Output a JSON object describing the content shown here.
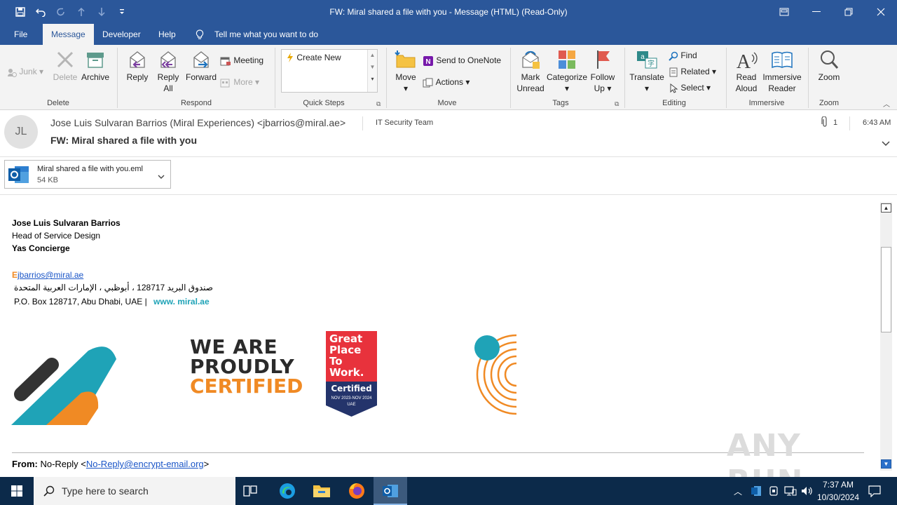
{
  "window": {
    "title": "FW: Miral shared a file with you  -  Message (HTML) (Read-Only)"
  },
  "menu": {
    "tabs": [
      "File",
      "Message",
      "Developer",
      "Help"
    ],
    "tell_me": "Tell me what you want to do"
  },
  "ribbon": {
    "junk": "Junk",
    "delete": "Delete",
    "archive": "Archive",
    "reply": "Reply",
    "reply_all_1": "Reply",
    "reply_all_2": "All",
    "forward": "Forward",
    "meeting": "Meeting",
    "more": "More",
    "create_new": "Create New",
    "move": "Move",
    "send_onenote": "Send to OneNote",
    "actions": "Actions",
    "mark_unread_1": "Mark",
    "mark_unread_2": "Unread",
    "categorize": "Categorize",
    "follow_up_1": "Follow",
    "follow_up_2": "Up",
    "translate": "Translate",
    "find": "Find",
    "related": "Related",
    "select": "Select",
    "read_aloud_1": "Read",
    "read_aloud_2": "Aloud",
    "immersive_1": "Immersive",
    "immersive_2": "Reader",
    "zoom": "Zoom",
    "groups": {
      "delete": "Delete",
      "respond": "Respond",
      "quick_steps": "Quick Steps",
      "move": "Move",
      "tags": "Tags",
      "editing": "Editing",
      "immersive": "Immersive",
      "zoom": "Zoom"
    }
  },
  "message": {
    "avatar_initials": "JL",
    "sender": "Jose Luis Sulvaran Barrios (Miral Experiences) <jbarrios@miral.ae>",
    "to": "IT Security Team",
    "attachment_count": "1",
    "time": "6:43 AM",
    "subject": "FW: Miral shared a file with you",
    "attachment": {
      "name": "Miral shared a file with you.eml",
      "size": "54 KB"
    }
  },
  "signature": {
    "name": "Jose Luis Sulvaran Barrios",
    "title": "Head of Service Design",
    "company": "Yas Concierge",
    "email_prefix": "E",
    "email": "jbarrios@miral.ae",
    "address_ar": "صندوق البريد 128717 ، أبوظبي ، الإمارات العربية المتحدة",
    "address_en": "P.O. Box 128717,  Abu Dhabi, UAE  |",
    "website": "www. miral.ae",
    "cert_1": "WE ARE",
    "cert_2": "PROUDLY",
    "cert_3": "CERTIFIED",
    "gptw_1": "Great",
    "gptw_2": "Place",
    "gptw_3": "To",
    "gptw_4": "Work.",
    "gptw_5": "Certified",
    "gptw_6": "NOV 2023-NOV 2024",
    "gptw_7": "UAE"
  },
  "forwarded": {
    "from_label": "From:",
    "from_name": "No-Reply <",
    "from_email": "No-Reply@encrypt-email.org",
    "from_close": ">"
  },
  "watermark": "ANY RUN",
  "taskbar": {
    "search_placeholder": "Type here to search",
    "time": "7:37 AM",
    "date": "10/30/2024"
  },
  "colors": {
    "accent": "#2b579a",
    "teal": "#1fa3b7",
    "orange": "#f08a24"
  }
}
